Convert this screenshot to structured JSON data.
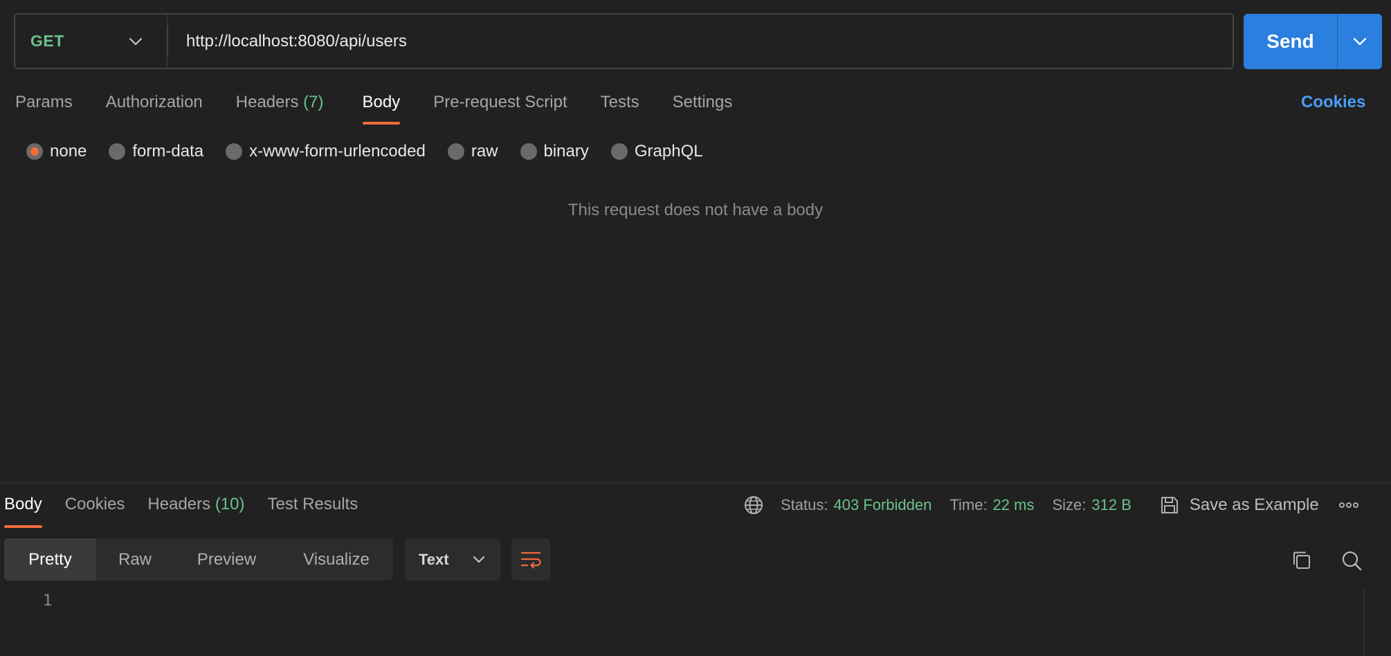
{
  "request": {
    "method": "GET",
    "url": "http://localhost:8080/api/users",
    "send_label": "Send"
  },
  "request_tabs": [
    {
      "label": "Params"
    },
    {
      "label": "Authorization"
    },
    {
      "label": "Headers",
      "count": "(7)"
    },
    {
      "label": "Body",
      "active": true
    },
    {
      "label": "Pre-request Script"
    },
    {
      "label": "Tests"
    },
    {
      "label": "Settings"
    }
  ],
  "cookies_link": "Cookies",
  "body_types": [
    {
      "label": "none",
      "checked": true
    },
    {
      "label": "form-data"
    },
    {
      "label": "x-www-form-urlencoded"
    },
    {
      "label": "raw"
    },
    {
      "label": "binary"
    },
    {
      "label": "GraphQL"
    }
  ],
  "body_empty_message": "This request does not have a body",
  "response": {
    "tabs": [
      {
        "label": "Body",
        "active": true
      },
      {
        "label": "Cookies"
      },
      {
        "label": "Headers",
        "count": "(10)"
      },
      {
        "label": "Test Results"
      }
    ],
    "status_label": "Status:",
    "status_value": "403 Forbidden",
    "time_label": "Time:",
    "time_value": "22 ms",
    "size_label": "Size:",
    "size_value": "312 B",
    "save_example_label": "Save as Example",
    "view_modes": [
      "Pretty",
      "Raw",
      "Preview",
      "Visualize"
    ],
    "active_view": "Pretty",
    "format": "Text",
    "line_number": "1"
  },
  "colors": {
    "accent": "#f26b3a",
    "method_green": "#6bc28b",
    "send_blue": "#2a7fdf",
    "link_blue": "#4a9df8"
  },
  "icons": [
    "chevron-down-icon",
    "globe-icon",
    "save-icon",
    "more-icon",
    "wrap-lines-icon",
    "copy-icon",
    "search-icon"
  ]
}
